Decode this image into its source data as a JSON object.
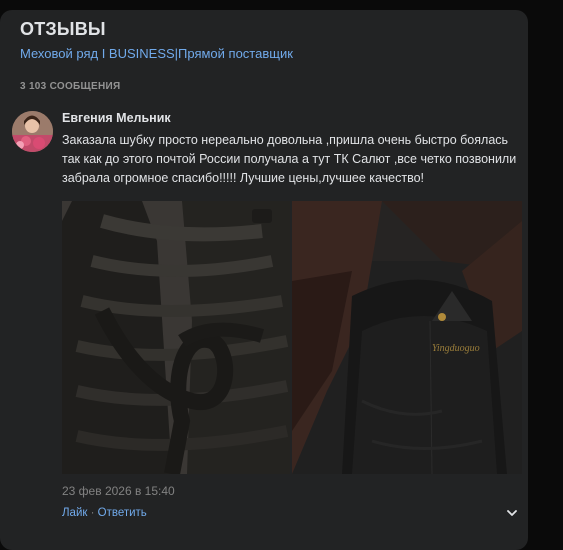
{
  "header": {
    "title": "ОТЗЫВЫ",
    "subtitle": "Меховой ряд I BUSINESS|Прямой поставщик",
    "message_count": "3 103 СООБЩЕНИЯ"
  },
  "comment": {
    "author": "Евгения Мельник",
    "text": "Заказала шубку просто нереально довольна ,пришла очень быстро боялась так как до этого почтой России получала а тут ТК Салют ,все четко позвонили забрала огромное спасибо!!!!! Лучшие цены,лучшее качество!",
    "timestamp": "23 фев 2026 в 15:40",
    "like_label": "Лайк",
    "separator": " · ",
    "reply_label": "Ответить",
    "photo_label": "Yingduoguo"
  },
  "colors": {
    "background": "#0a0a0a",
    "panel": "#222324",
    "text": "#e1e3e6",
    "link": "#71aaeb",
    "muted": "#828282"
  }
}
